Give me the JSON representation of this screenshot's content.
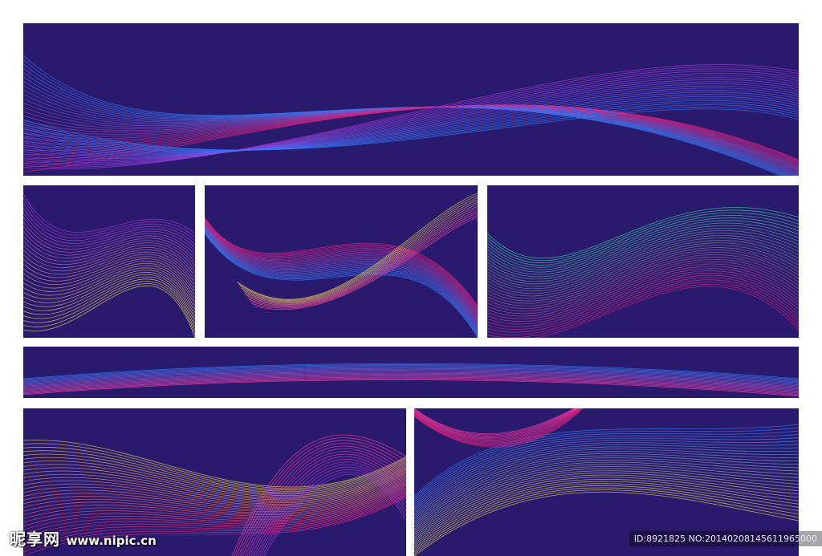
{
  "colors": {
    "background": "#2a1a6e",
    "page": "#ffffff",
    "wave_blue": "#2f7dff",
    "wave_magenta": "#e0207a",
    "wave_pink": "#ff3ca0",
    "wave_purple": "#a33bd6",
    "wave_yellow": "#e8d85a",
    "wave_green": "#35d9a0"
  },
  "watermark": {
    "brand": "昵享网",
    "url": "www.nipic.cn",
    "id_text": "ID:8921825 NO:20140208145611965000"
  }
}
